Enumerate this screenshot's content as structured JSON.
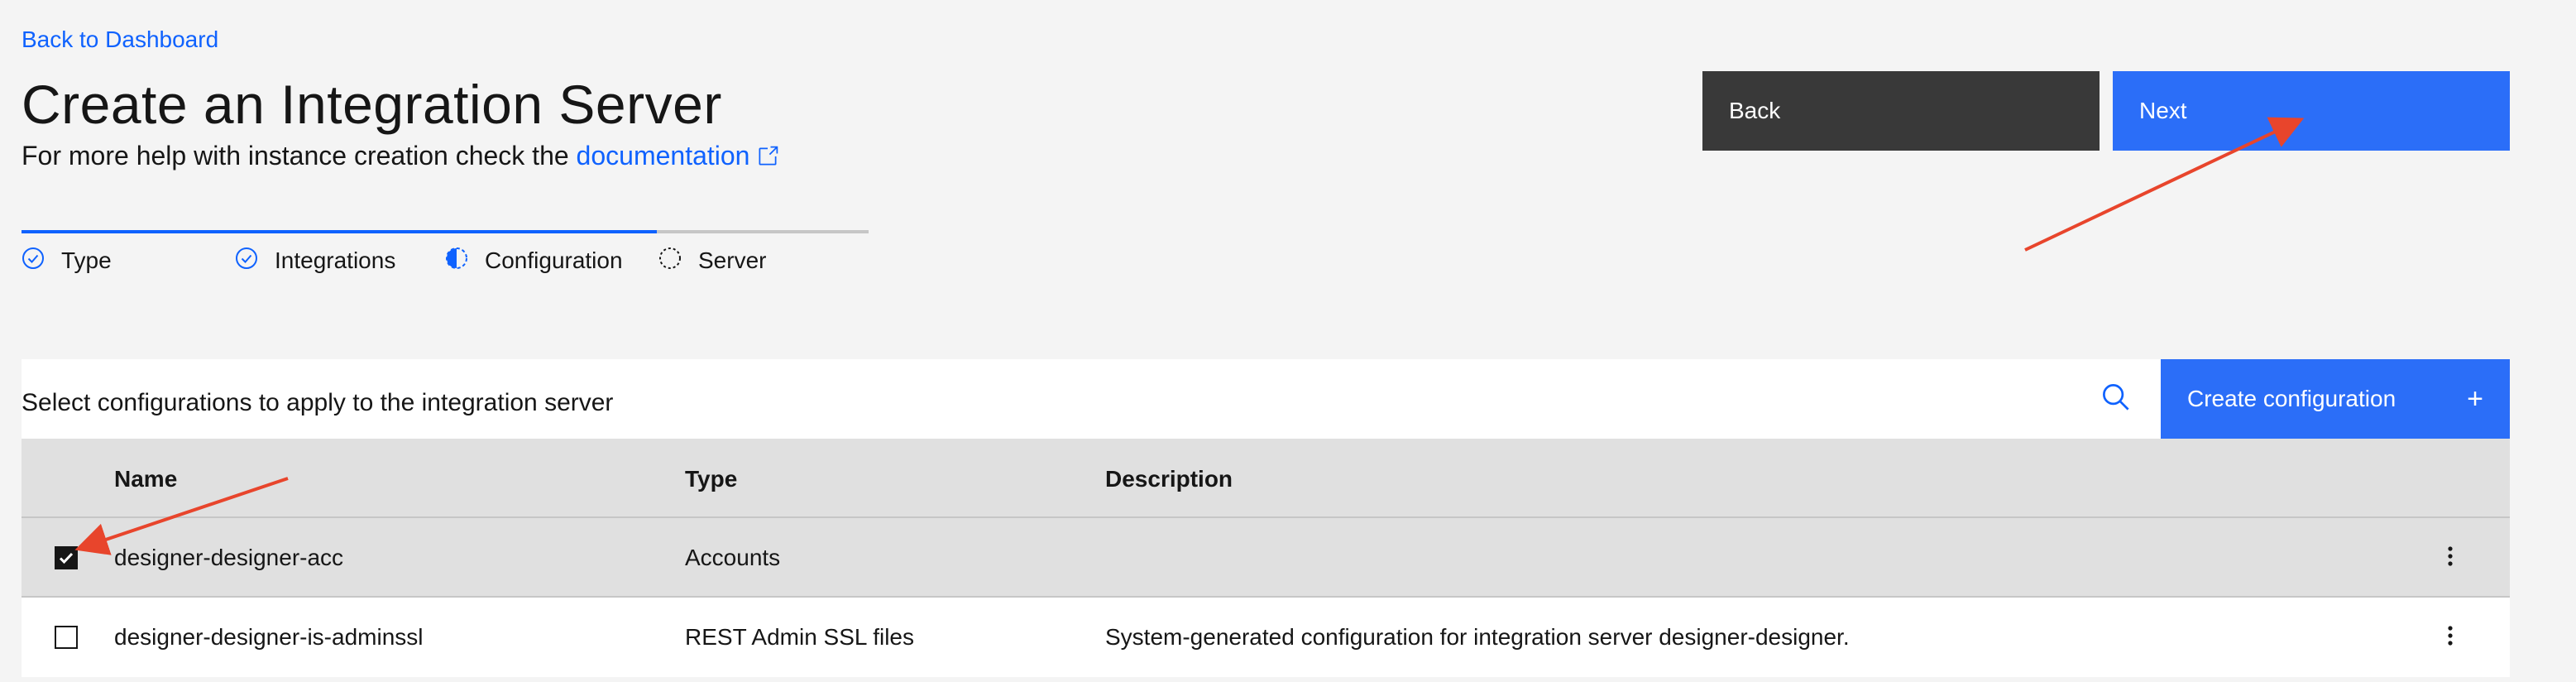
{
  "nav": {
    "back_link": "Back to Dashboard"
  },
  "header": {
    "title": "Create an Integration Server",
    "help_prefix": "For more help with instance creation check the ",
    "help_link": "documentation"
  },
  "actions": {
    "back_label": "Back",
    "next_label": "Next"
  },
  "progress": {
    "fraction_complete": 0.75,
    "steps": [
      {
        "label": "Type",
        "state": "complete"
      },
      {
        "label": "Integrations",
        "state": "complete"
      },
      {
        "label": "Configuration",
        "state": "current"
      },
      {
        "label": "Server",
        "state": "incomplete"
      }
    ]
  },
  "table": {
    "title": "Select configurations to apply to the integration server",
    "create_label": "Create configuration",
    "columns": [
      "Name",
      "Type",
      "Description"
    ],
    "rows": [
      {
        "name": "designer-designer-acc",
        "type": "Accounts",
        "description": "",
        "checked": true
      },
      {
        "name": "designer-designer-is-adminssl",
        "type": "REST Admin SSL files",
        "description": "System-generated configuration for integration server designer-designer.",
        "checked": false
      }
    ]
  },
  "colors": {
    "accent": "#0f62fe",
    "primary_button": "#2b6ef8",
    "secondary_button": "#393939",
    "annotation_arrow": "#e8452c"
  },
  "icons": [
    "external-link-icon",
    "checkmark-outline-icon",
    "incomplete-icon",
    "circle-dash-icon",
    "search-icon",
    "add-icon",
    "checkmark-icon",
    "overflow-menu-vertical-icon"
  ]
}
